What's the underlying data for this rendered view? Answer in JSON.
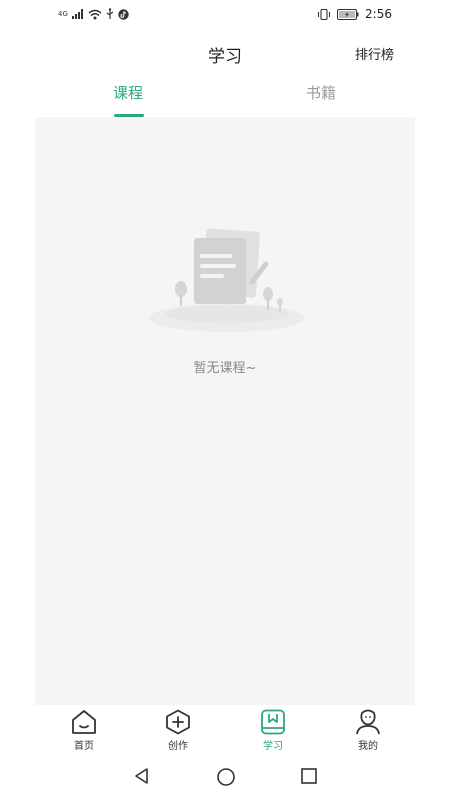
{
  "status_bar": {
    "network_label": "4G",
    "time": "2:56",
    "left_icons": [
      "signal-icon",
      "wifi-icon",
      "usb-icon",
      "tiktok-icon"
    ],
    "right_icons": [
      "vibrate-icon",
      "battery-icon"
    ]
  },
  "header": {
    "title": "学习",
    "ranking_label": "排行榜"
  },
  "tabs": [
    {
      "label": "课程",
      "active": true
    },
    {
      "label": "书籍",
      "active": false
    }
  ],
  "empty_state": {
    "message": "暂无课程~",
    "icon": "empty-document-illustration"
  },
  "bottom_nav": [
    {
      "label": "首页",
      "icon": "home-icon",
      "active": false
    },
    {
      "label": "创作",
      "icon": "create-icon",
      "active": false
    },
    {
      "label": "学习",
      "icon": "study-icon",
      "active": true
    },
    {
      "label": "我的",
      "icon": "profile-icon",
      "active": false
    }
  ],
  "system_nav": {
    "icons": [
      "back-icon",
      "home-circle-icon",
      "recents-icon"
    ]
  },
  "colors": {
    "accent": "#2aa883",
    "panel_bg": "#f5f5f5",
    "inactive_text": "#9a9a9a"
  }
}
